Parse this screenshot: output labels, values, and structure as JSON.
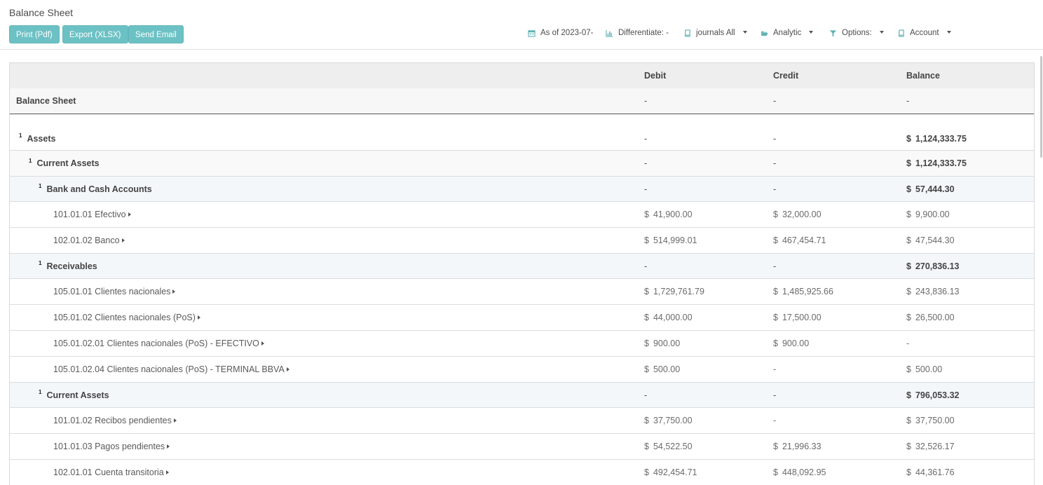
{
  "header": {
    "title": "Balance Sheet",
    "buttons": {
      "print": "Print (Pdf)",
      "export": "Export (XLSX)",
      "email": "Send Email"
    },
    "filters": {
      "date": "As of 2023-07-",
      "differentiate": "Differentiate: -",
      "journals": "journals All",
      "analytic": "Analytic",
      "options": "Options:",
      "account": "Account"
    }
  },
  "table": {
    "columns": {
      "debit": "Debit",
      "credit": "Credit",
      "balance": "Balance"
    },
    "title_row": {
      "name": "Balance Sheet",
      "debit": "-",
      "credit": "-",
      "balance": "-"
    },
    "rows": [
      {
        "type": "level",
        "indent": 1,
        "fold": "1",
        "name": "Assets",
        "debit": "-",
        "credit": "-",
        "balance_cur": "$",
        "balance": "1,124,333.75"
      },
      {
        "type": "level",
        "indent": 2,
        "fold": "1",
        "name": "Current Assets",
        "debit": "-",
        "credit": "-",
        "balance_cur": "$",
        "balance": "1,124,333.75"
      },
      {
        "type": "level",
        "indent": 3,
        "fold": "1",
        "name": "Bank and Cash Accounts",
        "debit": "-",
        "credit": "-",
        "balance_cur": "$",
        "balance": "57,444.30"
      },
      {
        "type": "account",
        "name": "101.01.01 Efectivo",
        "debit_cur": "$",
        "debit": "41,900.00",
        "credit_cur": "$",
        "credit": "32,000.00",
        "balance_cur": "$",
        "balance": "9,900.00"
      },
      {
        "type": "account",
        "name": "102.01.02 Banco",
        "debit_cur": "$",
        "debit": "514,999.01",
        "credit_cur": "$",
        "credit": "467,454.71",
        "balance_cur": "$",
        "balance": "47,544.30"
      },
      {
        "type": "level",
        "indent": 3,
        "fold": "1",
        "name": "Receivables",
        "debit": "-",
        "credit": "-",
        "balance_cur": "$",
        "balance": "270,836.13"
      },
      {
        "type": "account",
        "name": "105.01.01 Clientes nacionales",
        "debit_cur": "$",
        "debit": "1,729,761.79",
        "credit_cur": "$",
        "credit": "1,485,925.66",
        "balance_cur": "$",
        "balance": "243,836.13"
      },
      {
        "type": "account",
        "name": "105.01.02 Clientes nacionales (PoS)",
        "debit_cur": "$",
        "debit": "44,000.00",
        "credit_cur": "$",
        "credit": "17,500.00",
        "balance_cur": "$",
        "balance": "26,500.00"
      },
      {
        "type": "account",
        "name": "105.01.02.01 Clientes nacionales (PoS) - EFECTIVO",
        "debit_cur": "$",
        "debit": "900.00",
        "credit_cur": "$",
        "credit": "900.00",
        "balance_cur": "",
        "balance": "-"
      },
      {
        "type": "account",
        "name": "105.01.02.04 Clientes nacionales (PoS) - TERMINAL BBVA",
        "debit_cur": "$",
        "debit": "500.00",
        "credit_cur": "",
        "credit": "-",
        "balance_cur": "$",
        "balance": "500.00"
      },
      {
        "type": "level",
        "indent": 3,
        "fold": "1",
        "name": "Current Assets",
        "debit": "-",
        "credit": "-",
        "balance_cur": "$",
        "balance": "796,053.32"
      },
      {
        "type": "account",
        "name": "101.01.02 Recibos pendientes",
        "debit_cur": "$",
        "debit": "37,750.00",
        "credit_cur": "",
        "credit": "-",
        "balance_cur": "$",
        "balance": "37,750.00"
      },
      {
        "type": "account",
        "name": "101.01.03 Pagos pendientes",
        "debit_cur": "$",
        "debit": "54,522.50",
        "credit_cur": "$",
        "credit": "21,996.33",
        "balance_cur": "$",
        "balance": "32,526.17"
      },
      {
        "type": "account",
        "name": "102.01.01 Cuenta transitoria",
        "debit_cur": "$",
        "debit": "492,454.71",
        "credit_cur": "$",
        "credit": "448,092.95",
        "balance_cur": "$",
        "balance": "44,361.76"
      }
    ]
  },
  "colors": {
    "button": "#6cc1c4",
    "icon": "#5fb1b4",
    "header_bg": "#eeeeee",
    "level_bg": "#f4f7fa"
  }
}
